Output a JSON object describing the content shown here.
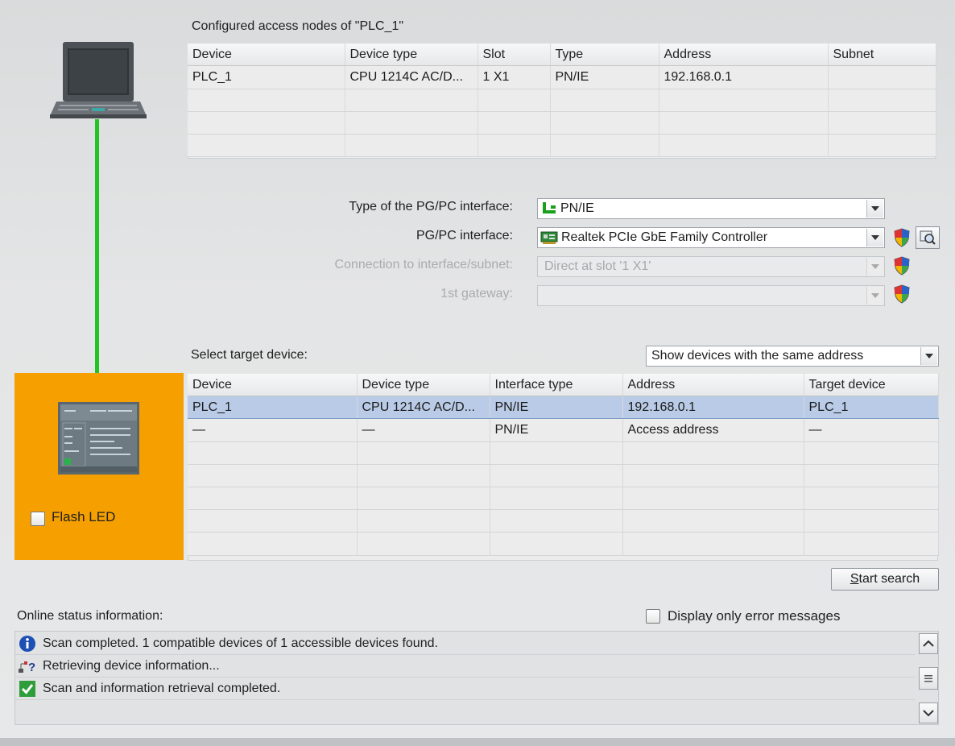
{
  "configured": {
    "title": "Configured access nodes of \"PLC_1\"",
    "columns": [
      "Device",
      "Device type",
      "Slot",
      "Type",
      "Address",
      "Subnet"
    ],
    "rows": [
      [
        "PLC_1",
        "CPU 1214C AC/D...",
        "1 X1",
        "PN/IE",
        "192.168.0.1",
        ""
      ]
    ]
  },
  "interface": {
    "type_label": "Type of the PG/PC interface:",
    "type_value": "PN/IE",
    "pgpc_label": "PG/PC interface:",
    "pgpc_value": "Realtek PCIe GbE Family Controller",
    "connection_label": "Connection to interface/subnet:",
    "connection_value": "Direct at slot '1 X1'",
    "gateway_label": "1st gateway:",
    "gateway_value": ""
  },
  "target": {
    "label": "Select target device:",
    "filter_value": "Show devices with the same address",
    "columns": [
      "Device",
      "Device type",
      "Interface type",
      "Address",
      "Target device"
    ],
    "rows": [
      [
        "PLC_1",
        "CPU 1214C AC/D...",
        "PN/IE",
        "192.168.0.1",
        "PLC_1"
      ],
      [
        "—",
        "—",
        "PN/IE",
        "Access address",
        "—"
      ]
    ]
  },
  "flash_led_label": "Flash LED",
  "start_search_prefix": "S",
  "start_search_rest": "tart search",
  "status": {
    "label": "Online status information:",
    "errors_only_label": "Display only error messages",
    "messages": [
      {
        "icon": "info-icon",
        "text": "Scan completed. 1 compatible devices of 1 accessible devices found."
      },
      {
        "icon": "network-search-icon",
        "text": "Retrieving device information..."
      },
      {
        "icon": "check-icon",
        "text": "Scan and information retrieval completed."
      }
    ]
  },
  "colors": {
    "accent_orange": "#f59f00",
    "link_green": "#22c322",
    "selection_blue": "#b9cbe6"
  }
}
